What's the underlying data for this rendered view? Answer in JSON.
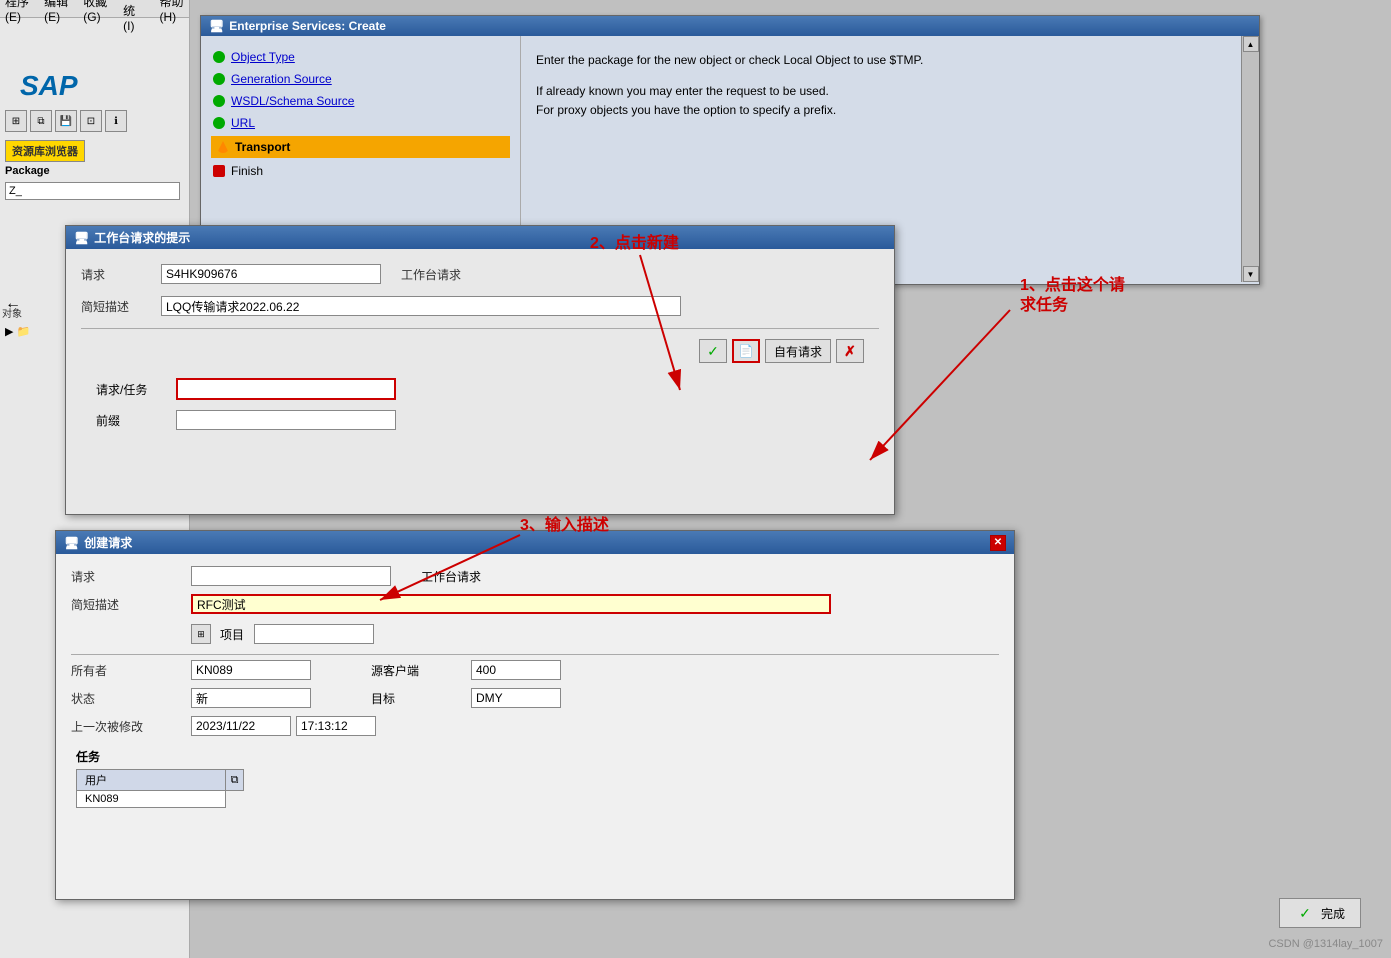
{
  "menubar": {
    "items": [
      "程序(E)",
      "编辑(E)",
      "收藏(G)",
      "系统(I)",
      "帮助(H)"
    ]
  },
  "enterprise_window": {
    "title": "Enterprise Services: Create",
    "nav_items": [
      {
        "id": "object-type",
        "label": "Object Type",
        "dot": "green",
        "type": "link"
      },
      {
        "id": "generation-source",
        "label": "Generation Source",
        "dot": "green",
        "type": "link"
      },
      {
        "id": "wsdl-schema",
        "label": "WSDL/Schema Source",
        "dot": "green",
        "type": "link"
      },
      {
        "id": "url",
        "label": "URL",
        "dot": "green",
        "type": "link"
      },
      {
        "id": "transport",
        "label": "Transport",
        "dot": "orange",
        "type": "active"
      },
      {
        "id": "finish",
        "label": "Finish",
        "dot": "red",
        "type": "plain"
      }
    ],
    "description_line1": "Enter the package for the new object or check Local Object to use $TMP.",
    "description_line2": "",
    "description_line3": "If already known you may enter the request to be used.",
    "description_line4": "For proxy objects you have the option to specify a prefix."
  },
  "sap": {
    "logo": "SAP",
    "resource_browser": "资源库浏览器",
    "package_label": "Package",
    "package_value": "Z_"
  },
  "workbench_dialog": {
    "title": "工作台请求的提示",
    "request_label": "请求",
    "request_value": "S4HK909676",
    "workbench_request_label": "工作台请求",
    "short_desc_label": "简短描述",
    "short_desc_value": "LQQ传输请求2022.06.22",
    "btn_check": "✓",
    "btn_new_icon": "📄",
    "btn_own_request": "自有请求",
    "btn_cancel": "✗",
    "request_task_label": "请求/任务",
    "prefix_label": "前缀"
  },
  "create_request_dialog": {
    "title": "创建请求",
    "request_label": "请求",
    "workbench_label": "工作台请求",
    "short_desc_label": "简短描述",
    "short_desc_value": "RFC测试",
    "projekt_label": "项目",
    "owner_label": "所有者",
    "owner_value": "KN089",
    "source_client_label": "源客户端",
    "source_client_value": "400",
    "status_label": "状态",
    "status_value": "新",
    "target_label": "目标",
    "target_value": "DMY",
    "last_modified_label": "上一次被修改",
    "last_modified_date": "2023/11/22",
    "last_modified_time": "17:13:12",
    "tasks_label": "任务",
    "tasks_col_user": "用户",
    "tasks_row_user": "KN089"
  },
  "annotations": {
    "step1": "1、点击这个请\n求任务",
    "step2": "2、点击新建",
    "step3": "3、输入描述"
  },
  "complete_button": {
    "label": "完成"
  },
  "csdn": {
    "watermark": "CSDN @1314lay_1007"
  }
}
